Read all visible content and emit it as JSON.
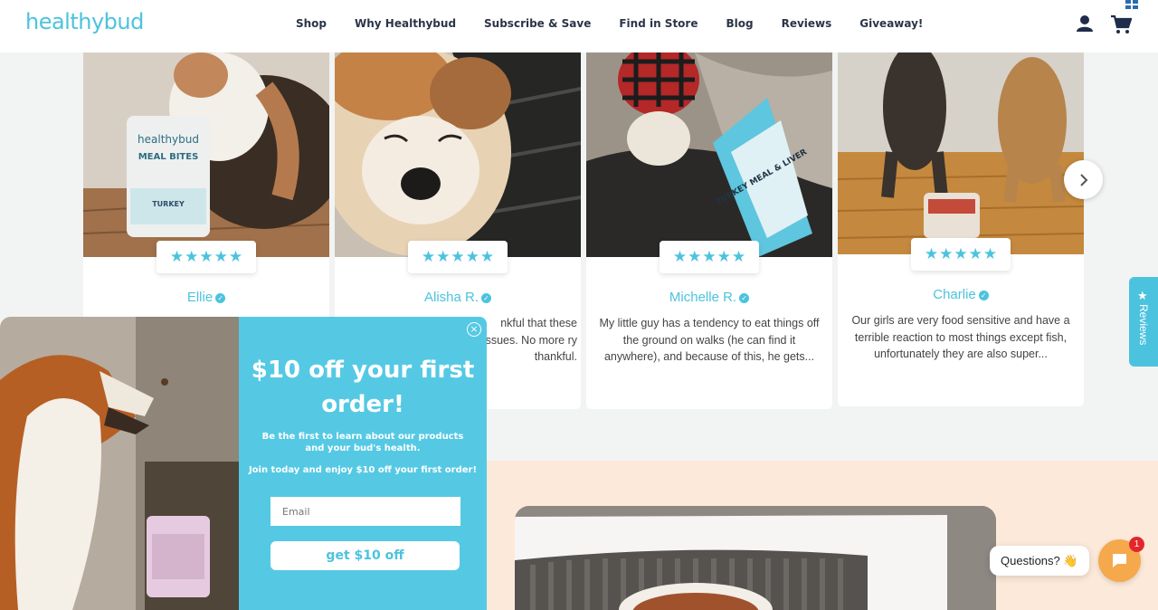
{
  "header": {
    "logo": "healthybud",
    "nav": [
      "Shop",
      "Why Healthybud",
      "Subscribe & Save",
      "Find in Store",
      "Blog",
      "Reviews",
      "Giveaway!"
    ]
  },
  "reviews": [
    {
      "name": "Ellie",
      "rating": 5,
      "text": ""
    },
    {
      "name": "Alisha R.",
      "rating": 5,
      "text": "nkful that these ssues. No more ry thankful."
    },
    {
      "name": "Michelle R.",
      "rating": 5,
      "text": "My little guy has a tendency to eat things off the ground on walks (he can find it anywhere), and because of this, he gets..."
    },
    {
      "name": "Charlie",
      "rating": 5,
      "text": "Our girls are very food sensitive and have a terrible reaction to most things except fish, unfortunately they are also super..."
    }
  ],
  "side_tab": {
    "label": "Reviews"
  },
  "popup": {
    "headline": "$10 off your first order!",
    "line1": "Be the first to learn about our products and your bud's health.",
    "line2": "Join today and enjoy $10 off your first order!",
    "email_placeholder": "Email",
    "cta": "get $10 off",
    "close": "×"
  },
  "product_bag_text": [
    "healthybud",
    "MEAL BITES",
    "TURKEY",
    "TURKEY MEAL & LIVER"
  ],
  "chat": {
    "bubble": "Questions? 👋",
    "badge": "1"
  },
  "colors": {
    "brand": "#4cc3de",
    "popup_bg": "#55c9e4",
    "peach": "#fde9d9",
    "chat": "#f5a94c"
  }
}
